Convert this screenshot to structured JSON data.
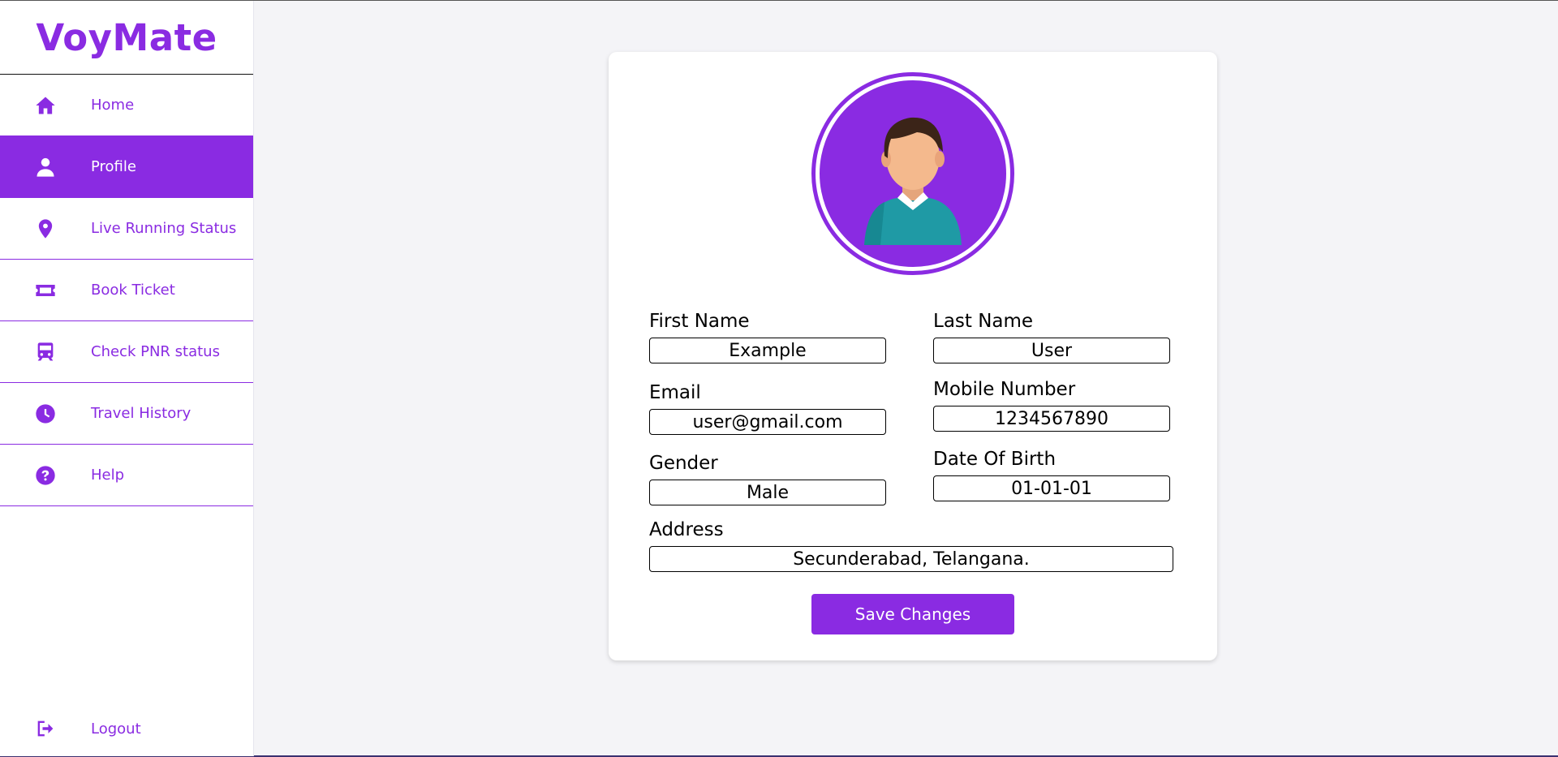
{
  "app": {
    "brand": "VoyMate"
  },
  "colors": {
    "accent": "#8a2be2"
  },
  "sidebar": {
    "items": [
      {
        "label": "Home",
        "icon": "home-icon",
        "active": false
      },
      {
        "label": "Profile",
        "icon": "user-icon",
        "active": true
      },
      {
        "label": "Live Running Status",
        "icon": "location-pin-icon",
        "active": false
      },
      {
        "label": "Book Ticket",
        "icon": "ticket-icon",
        "active": false
      },
      {
        "label": "Check PNR status",
        "icon": "train-icon",
        "active": false
      },
      {
        "label": "Travel History",
        "icon": "clock-icon",
        "active": false
      },
      {
        "label": "Help",
        "icon": "question-circle-icon",
        "active": false
      }
    ],
    "logout": {
      "label": "Logout",
      "icon": "logout-icon"
    }
  },
  "profile": {
    "avatar_icon": "user-avatar-icon",
    "first_name": {
      "label": "First Name",
      "value": "Example"
    },
    "last_name": {
      "label": "Last Name",
      "value": "User"
    },
    "email": {
      "label": "Email",
      "value": "user@gmail.com"
    },
    "mobile": {
      "label": "Mobile Number",
      "value": "1234567890"
    },
    "gender": {
      "label": "Gender",
      "value": "Male"
    },
    "dob": {
      "label": "Date Of Birth",
      "value": "01-01-01"
    },
    "address": {
      "label": "Address",
      "value": "Secunderabad, Telangana."
    },
    "save_label": "Save Changes"
  }
}
